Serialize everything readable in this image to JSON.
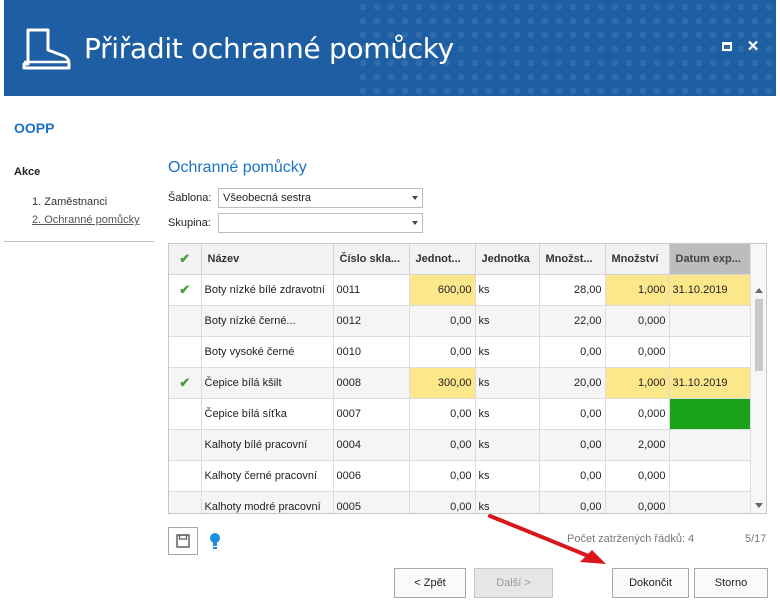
{
  "window": {
    "title": "Přiřadit ochranné pomůcky"
  },
  "section_code": "OOPP",
  "steps": {
    "title": "Akce",
    "items": [
      {
        "label": "1. Zaměstnanci"
      },
      {
        "label": "2. Ochranné pomůcky"
      }
    ]
  },
  "main": {
    "title": "Ochranné pomůcky",
    "sablona_label": "Šablona:",
    "sablona_value": "Všeobecná sestra",
    "skupina_label": "Skupina:",
    "skupina_value": ""
  },
  "grid": {
    "columns": [
      "✔",
      "Název",
      "Číslo skla...",
      "Jednot...",
      "Jednotka",
      "Množst...",
      "Množství",
      "Datum exp..."
    ],
    "rows": [
      {
        "checked": "✔",
        "nazev": "Boty nízké bílé zdravotní",
        "cislo": "0011",
        "jednot": "600,00",
        "jednotka": "ks",
        "mnozst": "28,00",
        "mnozstvi": "1,000",
        "datum": "31.10.2019"
      },
      {
        "checked": "",
        "nazev": "Boty nízké černé...",
        "cislo": "0012",
        "jednot": "0,00",
        "jednotka": "ks",
        "mnozst": "22,00",
        "mnozstvi": "0,000",
        "datum": ""
      },
      {
        "checked": "",
        "nazev": "Boty vysoké černé",
        "cislo": "0010",
        "jednot": "0,00",
        "jednotka": "ks",
        "mnozst": "0,00",
        "mnozstvi": "0,000",
        "datum": ""
      },
      {
        "checked": "✔",
        "nazev": "Čepice bílá kšilt",
        "cislo": "0008",
        "jednot": "300,00",
        "jednotka": "ks",
        "mnozst": "20,00",
        "mnozstvi": "1,000",
        "datum": "31.10.2019"
      },
      {
        "checked": "",
        "nazev": "Čepice bílá síťka",
        "cislo": "0007",
        "jednot": "0,00",
        "jednotka": "ks",
        "mnozst": "0,00",
        "mnozstvi": "0,000",
        "datum": ""
      },
      {
        "checked": "",
        "nazev": "Kalhoty bílé pracovní",
        "cislo": "0004",
        "jednot": "0,00",
        "jednotka": "ks",
        "mnozst": "0,00",
        "mnozstvi": "2,000",
        "datum": ""
      },
      {
        "checked": "",
        "nazev": "Kalhoty černé pracovní",
        "cislo": "0006",
        "jednot": "0,00",
        "jednotka": "ks",
        "mnozst": "0,00",
        "mnozstvi": "0,000",
        "datum": ""
      },
      {
        "checked": "",
        "nazev": "Kalhoty modré pracovní",
        "cislo": "0005",
        "jednot": "0,00",
        "jednotka": "ks",
        "mnozst": "0,00",
        "mnozstvi": "0,000",
        "datum": ""
      }
    ]
  },
  "footer": {
    "checked_count": "Počet zatržených řádků: 4",
    "page_count": "5/17"
  },
  "buttons": {
    "back": "< Zpět",
    "next": "Další >",
    "finish": "Dokončit",
    "cancel": "Storno"
  },
  "icons": {
    "header": "boot-icon",
    "save": "save-icon",
    "hint": "lightbulb-icon",
    "annotation": "red-arrow"
  },
  "colors": {
    "header_bg": "#1e5ea3",
    "accent_text": "#1b73c4",
    "highlight_yellow": "#fde78b",
    "highlight_green": "#1aa31a",
    "check_green": "#47a03c",
    "annotation_red": "#d9161c"
  }
}
